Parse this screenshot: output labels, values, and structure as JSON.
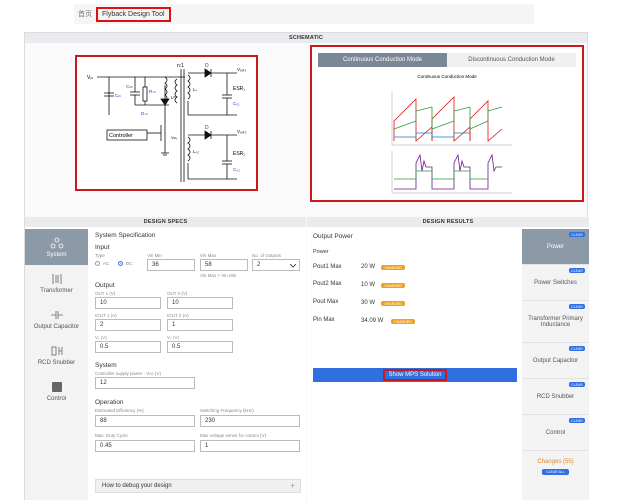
{
  "breadcrumb": {
    "home": "首页",
    "current": "Flyback Design Tool"
  },
  "sections": {
    "schematic": "SCHEMATIC",
    "design_specs": "DESIGN SPECS",
    "design_results": "DESIGN RESULTS"
  },
  "schematic": {
    "labels": {
      "vin": "Vᵢₙ",
      "cin": "Cᵢₙ",
      "cclamp": "Cₗₘ",
      "rsn": "Rₛₙ",
      "dsn": "Dₛₙ",
      "lm": "Lᵐ",
      "ratio": "n:1",
      "d1": "D",
      "vout1": "Vₒᵤₜ₁",
      "esr1": "ESR₁",
      "co1": "C₀₁",
      "d2": "D",
      "vout2": "Vₒᵤₜ₂",
      "esr2": "ESR₂",
      "co2": "C₀₂",
      "controller": "Controller",
      "vds": "Vᴅₛ",
      "l1": "Lₛ",
      "l2": "Lₛ₂"
    },
    "mode_tabs": [
      "Continuous Conduction Mode",
      "Discontinuous Conduction Mode"
    ],
    "waveform_title": "Continuous  Conduction Mode"
  },
  "nav": {
    "items": [
      "System",
      "Transformer",
      "Output Capacitor",
      "RCD Snubber",
      "Control"
    ]
  },
  "spec": {
    "title": "System Specification",
    "input": {
      "heading": "Input",
      "type_label": "Type",
      "ac": "AC",
      "dc": "DC",
      "vin_min_label": "Vin Min",
      "vin_min": "36",
      "vin_max_label": "Vin Max",
      "vin_max": "58",
      "outputs_label": "No. of Outputs",
      "outputs": "2",
      "hint": "Vin Max > Vin Min"
    },
    "output": {
      "heading": "Output",
      "out1_v_label": "OUT 1 (V)",
      "out1_v": "10",
      "out2_v_label": "OUT 2 (V)",
      "out2_v": "10",
      "iout1_label": "IOUT 1 (A)",
      "iout1": "2",
      "iout2_label": "IOUT 2 (A)",
      "iout2": "1",
      "vf1_label": "V₁ (V)",
      "vf1": "0.5",
      "vf2_label": "V₂ (V)",
      "vf2": "0.5"
    },
    "system": {
      "heading": "System",
      "vcc_label": "Controller supply power - Vcc (V)",
      "vcc": "12"
    },
    "operation": {
      "heading": "Operation",
      "eff_label": "Estimated Efficiency (%)",
      "eff": "88",
      "fsw_label": "Switching Frequency (kHz)",
      "fsw": "230",
      "duty_label": "Max. Duty Cycle",
      "duty": "0.45",
      "vsense_label": "Max voltage sense for control (V)",
      "vsense": "1"
    },
    "debug": "How to debug your design"
  },
  "results": {
    "title": "Output Power",
    "power_heading": "Power",
    "rows": [
      {
        "label": "Pout1 Max",
        "value": "20 W",
        "badge": "CHANGED"
      },
      {
        "label": "Pout2 Max",
        "value": "10 W",
        "badge": "CHANGED"
      },
      {
        "label": "Pout Max",
        "value": "30 W",
        "badge": "CHANGED"
      },
      {
        "label": "Pin Max",
        "value": "34.09 W",
        "badge": "CHANGED"
      }
    ],
    "mps_button": "Show MPS Solution",
    "nav": [
      "Power",
      "Power Switches",
      "Transformer Primary Inductance",
      "Output Capacitor",
      "RCD Snubber",
      "Control"
    ],
    "clear": "CLEAR",
    "changes": "Changes (55)",
    "clear_all": "CLEAR ALL"
  },
  "colors": {
    "highlight": "#c8191e",
    "accent_blue": "#2f6fe0",
    "nav_active": "#8c99a6",
    "badge": "#f0a020"
  }
}
